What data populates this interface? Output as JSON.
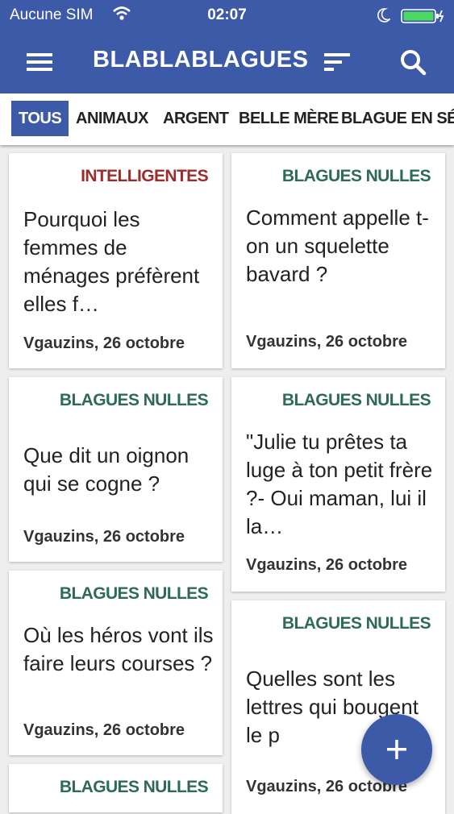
{
  "status_bar": {
    "carrier": "Aucune SIM",
    "time": "02:07"
  },
  "app": {
    "title": "BLABLABLAGUES"
  },
  "tabs": [
    "TOUS",
    "ANIMAUX",
    "ARGENT",
    "BELLE MÈRE",
    "BLAGUE EN SÉRIE"
  ],
  "colors": {
    "primary": "#3d5aa8",
    "intelligentes": "#9c2c2c",
    "nulles": "#2e6b55"
  },
  "cards": [
    {
      "category": "INTELLIGENTES",
      "text": "Pourquoi les femmes de ménages préfèrent elles f…",
      "meta": "Vgauzins, 26 octobre"
    },
    {
      "category": "BLAGUES NULLES",
      "text": "Comment appelle t-on un squelette bavard ?",
      "meta": "Vgauzins, 26 octobre"
    },
    {
      "category": "BLAGUES NULLES",
      "text": "Que dit un oignon qui se cogne ?",
      "meta": "Vgauzins, 26 octobre"
    },
    {
      "category": "BLAGUES NULLES",
      "text": "\"Julie tu prêtes ta luge à ton petit frère ?- Oui maman, lui il la…",
      "meta": "Vgauzins, 26 octobre"
    },
    {
      "category": "BLAGUES NULLES",
      "text": "Où les héros vont ils faire leurs courses ?",
      "meta": "Vgauzins, 26 octobre"
    },
    {
      "category": "BLAGUES NULLES",
      "text": "Quelles sont les lettres qui bougent le p",
      "meta": "Vgauzins, 26 octobre"
    },
    {
      "category": "BLAGUES NULLES",
      "text": "",
      "meta": ""
    }
  ],
  "icons": {
    "menu": "hamburger-icon",
    "sort": "sort-icon",
    "search": "search-icon",
    "fab": "plus-icon",
    "wifi": "wifi-icon",
    "battery": "battery-icon",
    "moon": "moon-icon"
  }
}
